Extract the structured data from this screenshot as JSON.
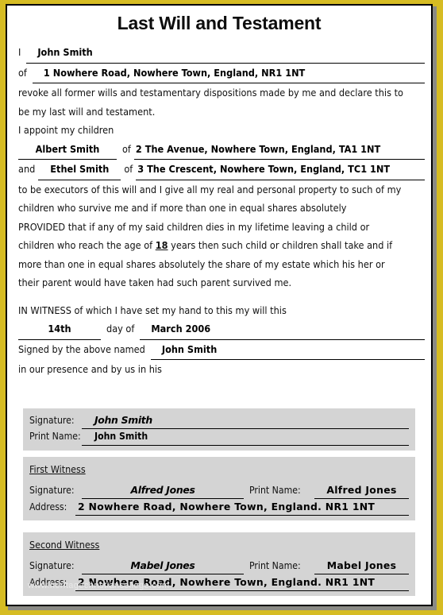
{
  "document": {
    "title": "Last Will and Testament",
    "watermark": "www.heritagechristiancollege.com"
  },
  "testator": {
    "i_label": "I",
    "name": "John Smith",
    "of_label": "of",
    "address": "1 Nowhere Road, Nowhere Town, England, NR1 1NT"
  },
  "revocation": {
    "line1": "revoke all former wills and testamentary dispositions made by me and declare this to",
    "line2": "be my last will and testament."
  },
  "executors": {
    "intro": "I appoint my children",
    "child1": {
      "name": "Albert Smith",
      "of_label": "of",
      "address": "2 The Avenue, Nowhere Town, England, TA1 1NT"
    },
    "and_label": "and",
    "child2": {
      "name": "Ethel Smith",
      "of_label": "of",
      "address": "3 The Crescent, Nowhere Town, England, TC1 1NT"
    }
  },
  "bequest": {
    "line1": "to be executors of this will and I give all my real and personal property to such of my",
    "line2": "children who survive me and if more than one in equal shares absolutely",
    "line3": "PROVIDED that if any of my said children dies in my lifetime leaving a child or",
    "line4_pre": "children who reach the age of",
    "age": "18",
    "line4_post": "years then such child or children shall take and if",
    "line5": "more than one in equal shares absolutely the share of my estate which his her or",
    "line6": "their parent would have taken had such parent survived me."
  },
  "attestation": {
    "in_witness": "IN WITNESS of which I have set my hand to this my will this",
    "day": "14th",
    "day_of_label": "day of",
    "date": "March 2006",
    "signed_by_label": "Signed by the above named",
    "signed_by_name": "John Smith",
    "presence": "in our presence and by us in his"
  },
  "testator_block": {
    "signature_label": "Signature:",
    "signature_value": "John Smith",
    "print_name_label": "Print Name:",
    "print_name_value": "John Smith"
  },
  "witness1": {
    "heading": "First Witness",
    "signature_label": "Signature:",
    "signature_value": "Alfred Jones",
    "print_name_label": "Print Name:",
    "print_name_value": "Alfred Jones",
    "address_label": "Address:",
    "address_value": "2 Nowhere Road, Nowhere Town, England. NR1 1NT"
  },
  "witness2": {
    "heading": "Second Witness",
    "signature_label": "Signature:",
    "signature_value": "Mabel Jones",
    "print_name_label": "Print Name:",
    "print_name_value": "Mabel Jones",
    "address_label": "Address:",
    "address_value": "2 Nowhere Road, Nowhere Town, England. NR1 1NT"
  },
  "colors": {
    "frame_gold": "#d6bc23",
    "panel_grey": "#d4d4d4",
    "keyline_black": "#000000",
    "shadow_grey": "#8a8a85"
  }
}
